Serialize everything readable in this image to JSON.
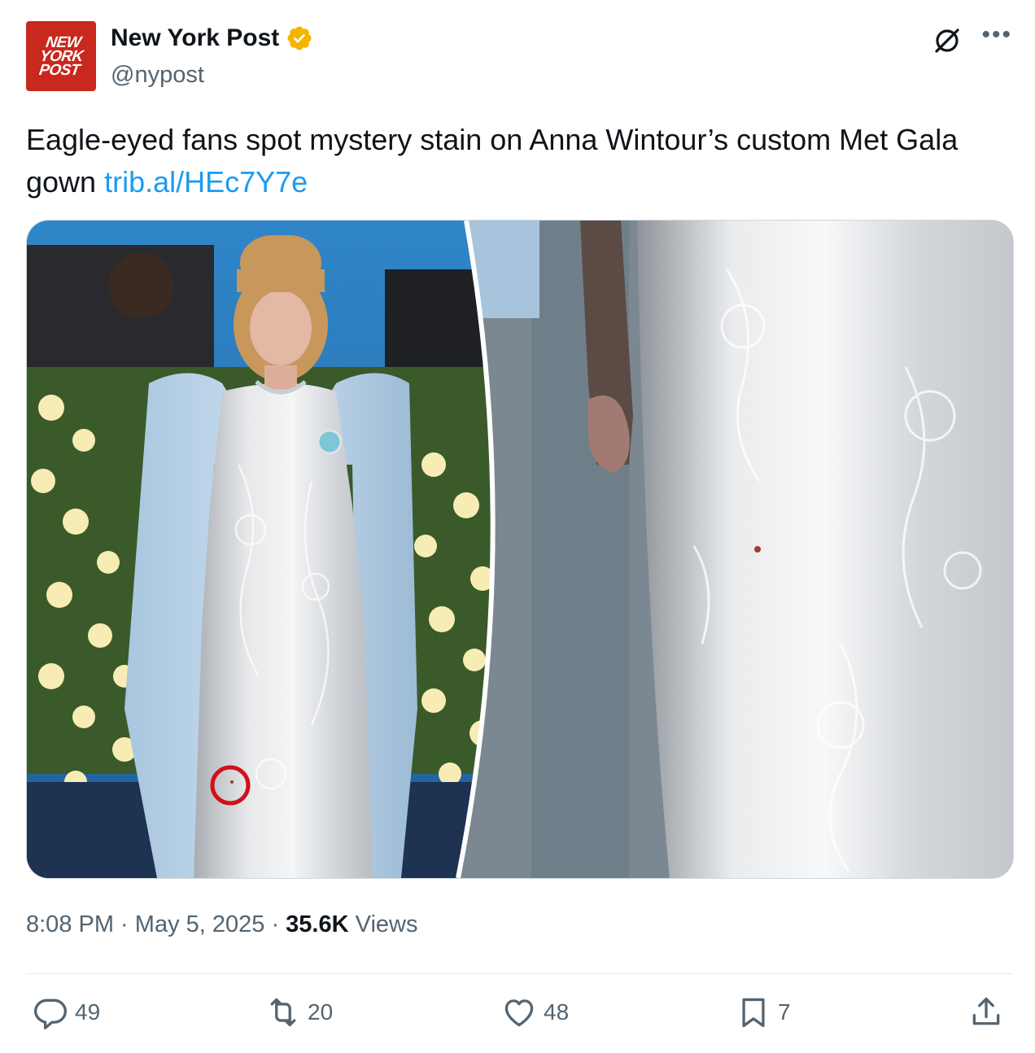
{
  "account": {
    "display_name": "New York Post",
    "handle": "@nypost",
    "logo_text": "NEW YORK POST",
    "verified_color": "#f4b400"
  },
  "tweet": {
    "text": "Eagle-eyed fans spot mystery stain on Anna Wintour’s custom Met Gala gown ",
    "link": "trib.al/HEc7Y7e"
  },
  "media": {
    "description_icons": [
      "photo-full-look",
      "photo-closeup-stain"
    ]
  },
  "meta": {
    "time": "8:08 PM",
    "separator": " · ",
    "date": "May 5, 2025",
    "views_count": "35.6K",
    "views_label": " Views"
  },
  "actions": {
    "replies": "49",
    "reposts": "20",
    "likes": "48",
    "bookmarks": "7"
  },
  "colors": {
    "link": "#1d9bf0",
    "secondary_text": "#536471",
    "brand_red": "#c8281e",
    "annotation_circle": "#d0101a"
  }
}
